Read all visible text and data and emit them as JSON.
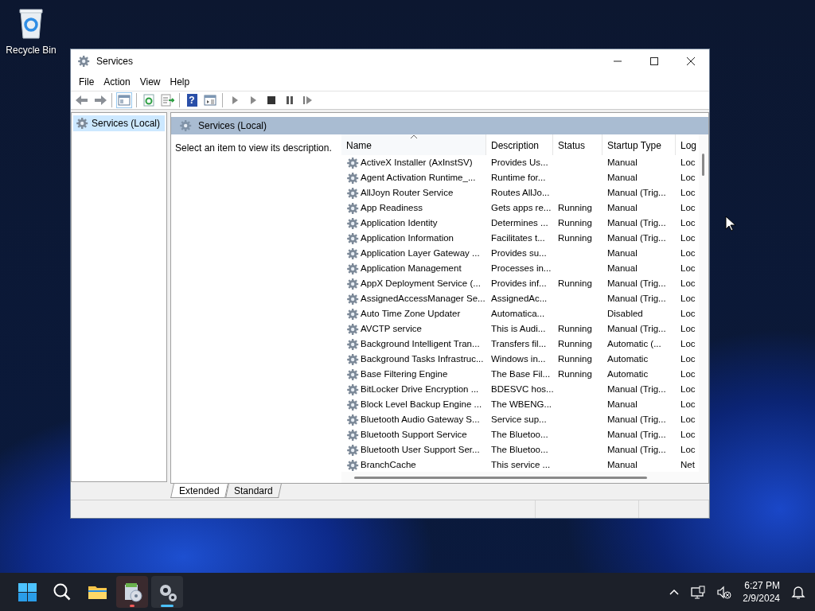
{
  "desktop_icons": [
    {
      "kind": "recycle-bin",
      "label": "Recycle Bin"
    }
  ],
  "window": {
    "title": "Services"
  },
  "menu": [
    "File",
    "Action",
    "View",
    "Help"
  ],
  "toolbar": [
    {
      "kind": "back"
    },
    {
      "kind": "forward"
    },
    {
      "kind": "sep"
    },
    {
      "kind": "console-tree",
      "selected": true
    },
    {
      "kind": "sep"
    },
    {
      "kind": "refresh"
    },
    {
      "kind": "export"
    },
    {
      "kind": "sep"
    },
    {
      "kind": "help",
      "glyph": "?"
    },
    {
      "kind": "properties"
    },
    {
      "kind": "sep"
    },
    {
      "kind": "start"
    },
    {
      "kind": "start"
    },
    {
      "kind": "stop"
    },
    {
      "kind": "pause"
    },
    {
      "kind": "resume"
    }
  ],
  "tree": [
    {
      "label": "Services (Local)",
      "selected": true
    }
  ],
  "pane": {
    "title": "Services (Local)",
    "description": "Select an item to view its description."
  },
  "table": {
    "columns": [
      {
        "label": "Name",
        "sorted": true
      },
      {
        "label": "Description",
        "sorted": false
      },
      {
        "label": "Status",
        "sorted": false
      },
      {
        "label": "Startup Type",
        "sorted": false
      },
      {
        "label": "Log",
        "sorted": false
      }
    ],
    "rows": [
      [
        "ActiveX Installer (AxInstSV)",
        "Provides Us...",
        "",
        "Manual",
        "Loc"
      ],
      [
        "Agent Activation Runtime_...",
        "Runtime for...",
        "",
        "Manual",
        "Loc"
      ],
      [
        "AllJoyn Router Service",
        "Routes AllJo...",
        "",
        "Manual (Trig...",
        "Loc"
      ],
      [
        "App Readiness",
        "Gets apps re...",
        "Running",
        "Manual",
        "Loc"
      ],
      [
        "Application Identity",
        "Determines ...",
        "Running",
        "Manual (Trig...",
        "Loc"
      ],
      [
        "Application Information",
        "Facilitates t...",
        "Running",
        "Manual (Trig...",
        "Loc"
      ],
      [
        "Application Layer Gateway ...",
        "Provides su...",
        "",
        "Manual",
        "Loc"
      ],
      [
        "Application Management",
        "Processes in...",
        "",
        "Manual",
        "Loc"
      ],
      [
        "AppX Deployment Service (...",
        "Provides inf...",
        "Running",
        "Manual (Trig...",
        "Loc"
      ],
      [
        "AssignedAccessManager Se...",
        "AssignedAc...",
        "",
        "Manual (Trig...",
        "Loc"
      ],
      [
        "Auto Time Zone Updater",
        "Automatica...",
        "",
        "Disabled",
        "Loc"
      ],
      [
        "AVCTP service",
        "This is Audi...",
        "Running",
        "Manual (Trig...",
        "Loc"
      ],
      [
        "Background Intelligent Tran...",
        "Transfers fil...",
        "Running",
        "Automatic (...",
        "Loc"
      ],
      [
        "Background Tasks Infrastruc...",
        "Windows in...",
        "Running",
        "Automatic",
        "Loc"
      ],
      [
        "Base Filtering Engine",
        "The Base Fil...",
        "Running",
        "Automatic",
        "Loc"
      ],
      [
        "BitLocker Drive Encryption ...",
        "BDESVC hos...",
        "",
        "Manual (Trig...",
        "Loc"
      ],
      [
        "Block Level Backup Engine ...",
        "The WBENG...",
        "",
        "Manual",
        "Loc"
      ],
      [
        "Bluetooth Audio Gateway S...",
        "Service sup...",
        "",
        "Manual (Trig...",
        "Loc"
      ],
      [
        "Bluetooth Support Service",
        "The Bluetoo...",
        "",
        "Manual (Trig...",
        "Loc"
      ],
      [
        "Bluetooth User Support Ser...",
        "The Bluetoo...",
        "",
        "Manual (Trig...",
        "Loc"
      ],
      [
        "BranchCache",
        "This service ...",
        "",
        "Manual",
        "Net"
      ]
    ]
  },
  "tabs": [
    {
      "label": "Extended",
      "selected": true
    },
    {
      "label": "Standard",
      "selected": false
    }
  ],
  "taskbar": {
    "apps": [
      {
        "kind": "start",
        "selected": false,
        "attention": false
      },
      {
        "kind": "search",
        "selected": false,
        "attention": false
      },
      {
        "kind": "explorer",
        "selected": false,
        "attention": false
      },
      {
        "kind": "installer",
        "selected": false,
        "attention": true
      },
      {
        "kind": "services",
        "selected": true,
        "attention": false
      }
    ],
    "time": "6:27 PM",
    "date": "2/9/2024"
  }
}
